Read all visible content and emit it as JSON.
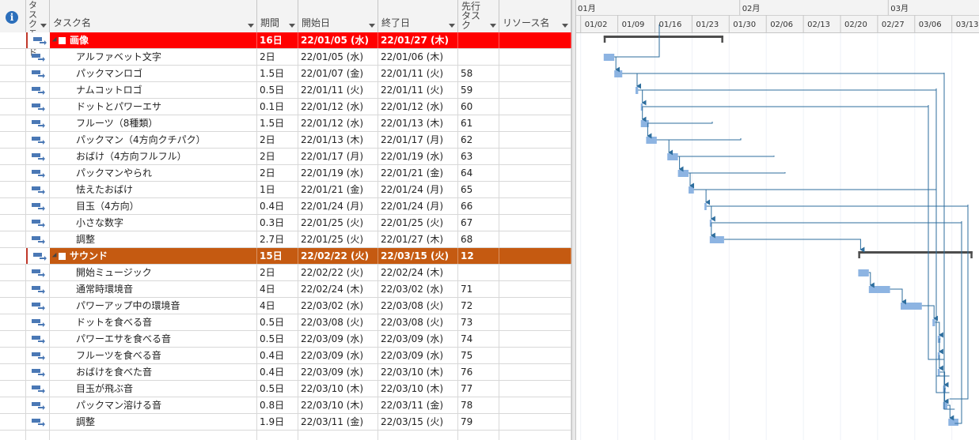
{
  "header": {
    "info_icon": "i",
    "mode": "タスク モード",
    "task_name": "タスク名",
    "duration": "期間",
    "start": "開始日",
    "finish": "終了日",
    "predecessors": "先行タスク",
    "resources": "リソース名"
  },
  "timeline": {
    "months": [
      "01月",
      "02月",
      "03月"
    ],
    "weeks": [
      "01/02",
      "01/09",
      "01/16",
      "01/23",
      "01/30",
      "02/06",
      "02/13",
      "02/20",
      "02/27",
      "03/06",
      "03/13"
    ]
  },
  "colors": {
    "summary1": "#ff0000",
    "summary2": "#c55a11",
    "bar": "#8db4e2",
    "link": "#2e6e9e",
    "summary_bar": "#4d4d4d"
  },
  "tasks": [
    {
      "name": "画像",
      "dur": "16日",
      "start": "22/01/05 (水)",
      "finish": "22/01/27 (木)",
      "pred": "",
      "summary": 1
    },
    {
      "name": "アルファベット文字",
      "dur": "2日",
      "start": "22/01/05 (水)",
      "finish": "22/01/06 (木)",
      "pred": ""
    },
    {
      "name": "パックマンロゴ",
      "dur": "1.5日",
      "start": "22/01/07 (金)",
      "finish": "22/01/11 (火)",
      "pred": "58"
    },
    {
      "name": "ナムコットロゴ",
      "dur": "0.5日",
      "start": "22/01/11 (火)",
      "finish": "22/01/11 (火)",
      "pred": "59"
    },
    {
      "name": "ドットとパワーエサ",
      "dur": "0.1日",
      "start": "22/01/12 (水)",
      "finish": "22/01/12 (水)",
      "pred": "60"
    },
    {
      "name": "フルーツ（8種類）",
      "dur": "1.5日",
      "start": "22/01/12 (水)",
      "finish": "22/01/13 (木)",
      "pred": "61"
    },
    {
      "name": "パックマン（4方向クチパク）",
      "dur": "2日",
      "start": "22/01/13 (木)",
      "finish": "22/01/17 (月)",
      "pred": "62"
    },
    {
      "name": "おばけ（4方向フルフル）",
      "dur": "2日",
      "start": "22/01/17 (月)",
      "finish": "22/01/19 (水)",
      "pred": "63"
    },
    {
      "name": "パックマンやられ",
      "dur": "2日",
      "start": "22/01/19 (水)",
      "finish": "22/01/21 (金)",
      "pred": "64"
    },
    {
      "name": "怯えたおばけ",
      "dur": "1日",
      "start": "22/01/21 (金)",
      "finish": "22/01/24 (月)",
      "pred": "65"
    },
    {
      "name": "目玉（4方向）",
      "dur": "0.4日",
      "start": "22/01/24 (月)",
      "finish": "22/01/24 (月)",
      "pred": "66"
    },
    {
      "name": "小さな数字",
      "dur": "0.3日",
      "start": "22/01/25 (火)",
      "finish": "22/01/25 (火)",
      "pred": "67"
    },
    {
      "name": "調整",
      "dur": "2.7日",
      "start": "22/01/25 (火)",
      "finish": "22/01/27 (木)",
      "pred": "68"
    },
    {
      "name": "サウンド",
      "dur": "15日",
      "start": "22/02/22 (火)",
      "finish": "22/03/15 (火)",
      "pred": "12",
      "summary": 2
    },
    {
      "name": "開始ミュージック",
      "dur": "2日",
      "start": "22/02/22 (火)",
      "finish": "22/02/24 (木)",
      "pred": ""
    },
    {
      "name": "通常時環境音",
      "dur": "4日",
      "start": "22/02/24 (木)",
      "finish": "22/03/02 (水)",
      "pred": "71"
    },
    {
      "name": "パワーアップ中の環境音",
      "dur": "4日",
      "start": "22/03/02 (水)",
      "finish": "22/03/08 (火)",
      "pred": "72"
    },
    {
      "name": "ドットを食べる音",
      "dur": "0.5日",
      "start": "22/03/08 (火)",
      "finish": "22/03/08 (火)",
      "pred": "73"
    },
    {
      "name": "パワーエサを食べる音",
      "dur": "0.5日",
      "start": "22/03/09 (水)",
      "finish": "22/03/09 (水)",
      "pred": "74"
    },
    {
      "name": "フルーツを食べる音",
      "dur": "0.4日",
      "start": "22/03/09 (水)",
      "finish": "22/03/09 (水)",
      "pred": "75"
    },
    {
      "name": "おばけを食べた音",
      "dur": "0.4日",
      "start": "22/03/09 (水)",
      "finish": "22/03/10 (木)",
      "pred": "76"
    },
    {
      "name": "目玉が飛ぶ音",
      "dur": "0.5日",
      "start": "22/03/10 (木)",
      "finish": "22/03/10 (木)",
      "pred": "77"
    },
    {
      "name": "パックマン溶ける音",
      "dur": "0.8日",
      "start": "22/03/10 (木)",
      "finish": "22/03/11 (金)",
      "pred": "78"
    },
    {
      "name": "調整",
      "dur": "1.9日",
      "start": "22/03/11 (金)",
      "finish": "22/03/15 (火)",
      "pred": "79"
    }
  ]
}
